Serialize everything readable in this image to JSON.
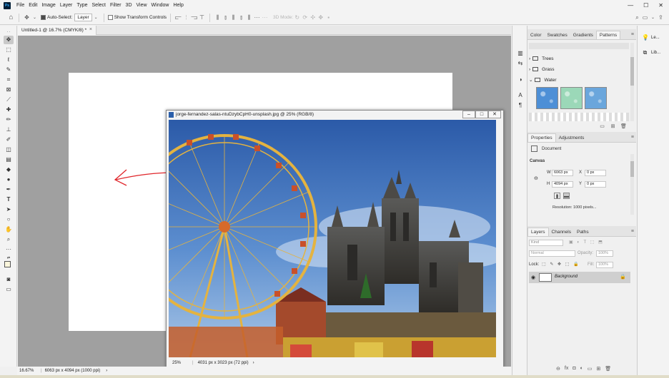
{
  "app": {
    "logo": "Ps"
  },
  "menubar": {
    "items": [
      "File",
      "Edit",
      "Image",
      "Layer",
      "Type",
      "Select",
      "Filter",
      "3D",
      "View",
      "Window",
      "Help"
    ],
    "minimize": "—",
    "maximize": "☐",
    "close": "✕"
  },
  "options": {
    "auto_select_label": "Auto-Select:",
    "auto_select_value": "Layer",
    "show_transform_label": "Show Transform Controls",
    "mode_3d_label": "3D Mode:"
  },
  "document": {
    "tab_title": "Untitled-1 @ 16.7% (CMYK/8) *",
    "zoom": "16.67%",
    "info": "6063 px x 4094 px (1000 ppi)"
  },
  "float_window": {
    "title": "jorge-fernandez-salas-ntuDzybCpH0-unsplash.jpg @ 25% (RGB/8)",
    "zoom": "25%",
    "info": "4031 px x 3023 px (72 ppi)"
  },
  "patterns_panel": {
    "tabs": [
      "Color",
      "Swatches",
      "Gradients",
      "Patterns"
    ],
    "active_tab": "Patterns",
    "groups": [
      "Trees",
      "Grass",
      "Water"
    ],
    "swatch_colors": [
      "#4d8fd6",
      "#9bd8b8",
      "#6aa6dc"
    ]
  },
  "properties_panel": {
    "tabs": [
      "Properties",
      "Adjustments"
    ],
    "section": "Document",
    "canvas_heading": "Canvas",
    "w_label": "W",
    "w_value": "6063 px",
    "h_label": "H",
    "h_value": "4094 px",
    "x_label": "X",
    "x_value": "0 px",
    "y_label": "Y",
    "y_value": "0 px",
    "resolution": "Resolution: 1000 pixels..."
  },
  "layers_panel": {
    "tabs": [
      "Layers",
      "Channels",
      "Paths"
    ],
    "filter_kind": "Kind",
    "blend_mode": "Normal",
    "opacity_label": "Opacity:",
    "opacity_value": "100%",
    "lock_label": "Lock:",
    "fill_label": "Fill:",
    "fill_value": "100%",
    "layer_name": "Background"
  },
  "libraries": {
    "items": [
      "Le...",
      "Lib..."
    ]
  },
  "colors": {
    "accent_blue": "#31a8ff",
    "arrow_red": "#e0262b",
    "canvas_gray": "#a0a0a0"
  }
}
